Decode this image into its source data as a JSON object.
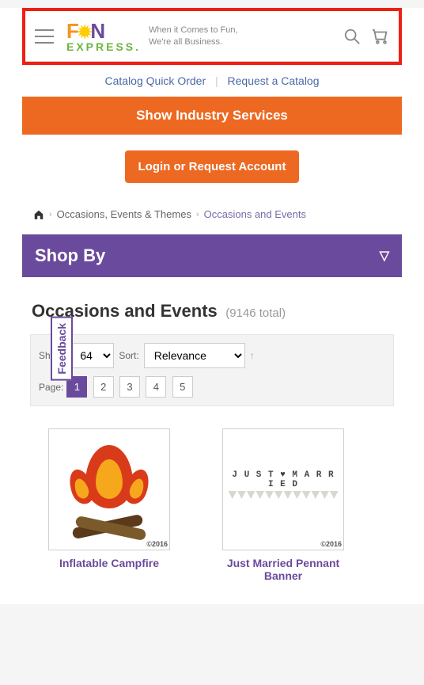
{
  "header": {
    "tagline_l1": "When it Comes to Fun,",
    "tagline_l2": "We're all Business.",
    "logo_text_express": "EXPRESS."
  },
  "quick_links": {
    "catalog_quick_order": "Catalog Quick Order",
    "request_catalog": "Request a Catalog"
  },
  "industry_bar": "Show Industry Services",
  "login_button": "Login or Request Account",
  "breadcrumb": {
    "l1": "Occasions, Events & Themes",
    "l2": "Occasions and Events"
  },
  "shopby": {
    "label": "Shop By"
  },
  "feedback": "Feedback",
  "title": {
    "heading": "Occasions and Events",
    "total": "(9146 total)"
  },
  "toolbar": {
    "show_label": "Show:",
    "show_value": "64",
    "sort_label": "Sort:",
    "sort_value": "Relevance",
    "page_label": "Page:",
    "pages": [
      "1",
      "2",
      "3",
      "4",
      "5"
    ],
    "current_page": "1"
  },
  "products": [
    {
      "name": "Inflatable Campfire",
      "copyright": "©2016"
    },
    {
      "name": "Just Married Pennant Banner",
      "banner_text": "J U S T ♥ M A R R I E D",
      "copyright": "©2016"
    }
  ]
}
